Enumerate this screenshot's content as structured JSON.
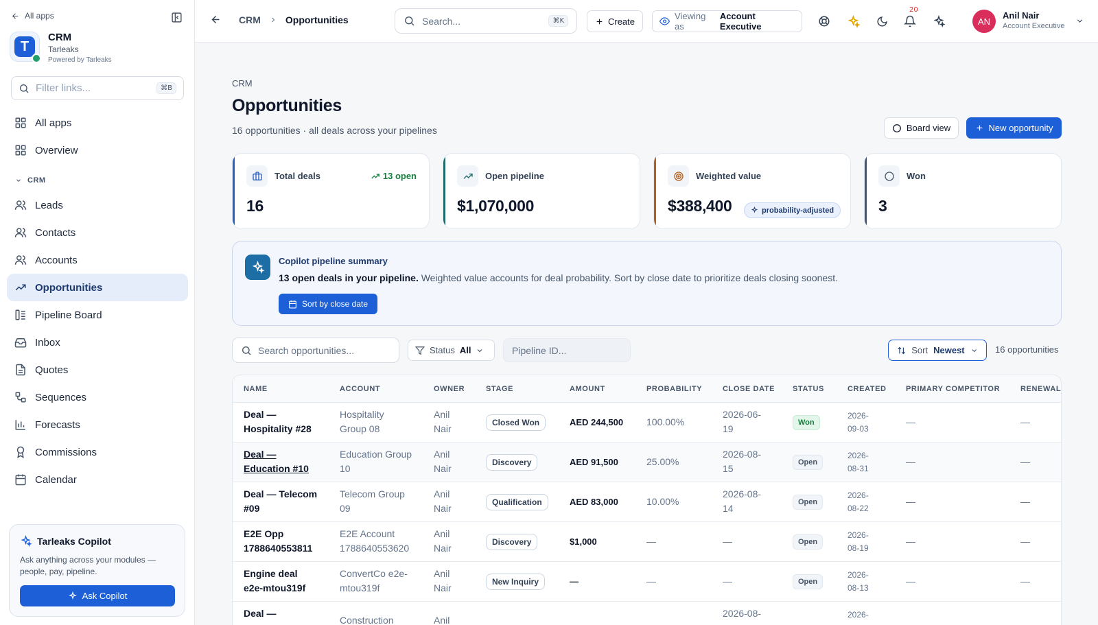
{
  "sidebar": {
    "back_label": "All apps",
    "app_title": "CRM",
    "app_org": "Tarleaks",
    "app_powered": "Powered by Tarleaks",
    "filter_placeholder": "Filter links...",
    "filter_kbd": "⌘B",
    "top_items": [
      {
        "label": "All apps",
        "icon": "grid-icon"
      },
      {
        "label": "Overview",
        "icon": "grid-icon"
      }
    ],
    "section_label": "CRM",
    "items": [
      {
        "label": "Leads",
        "icon": "users-icon"
      },
      {
        "label": "Contacts",
        "icon": "users-icon"
      },
      {
        "label": "Accounts",
        "icon": "users-icon"
      },
      {
        "label": "Opportunities",
        "icon": "trending-up-icon",
        "active": true
      },
      {
        "label": "Pipeline Board",
        "icon": "board-icon"
      },
      {
        "label": "Inbox",
        "icon": "inbox-icon"
      },
      {
        "label": "Quotes",
        "icon": "file-icon"
      },
      {
        "label": "Sequences",
        "icon": "sequence-icon"
      },
      {
        "label": "Forecasts",
        "icon": "bar-chart-icon"
      },
      {
        "label": "Commissions",
        "icon": "award-icon"
      },
      {
        "label": "Calendar",
        "icon": "calendar-icon"
      }
    ],
    "copilot": {
      "title": "Tarleaks Copilot",
      "description": "Ask anything across your modules — people, pay, pipeline.",
      "button": "Ask Copilot"
    }
  },
  "topbar": {
    "crumb_root": "CRM",
    "crumb_current": "Opportunities",
    "search_placeholder": "Search...",
    "search_kbd": "⌘K",
    "create_label": "Create",
    "viewing_label": "Viewing as",
    "viewing_value": "Account Executive",
    "notifications_count": "20",
    "user_initials": "AN",
    "user_name": "Anil Nair",
    "user_role": "Account Executive"
  },
  "page": {
    "crumb": "CRM",
    "title": "Opportunities",
    "subtitle": "16 opportunities · all deals across your pipelines",
    "board_view_label": "Board view",
    "new_opportunity_label": "New opportunity"
  },
  "stats": [
    {
      "label": "Total deals",
      "value": "16",
      "trend": "13 open",
      "accent": "#2c5fbf",
      "icon": "briefcase-icon"
    },
    {
      "label": "Open pipeline",
      "value": "$1,070,000",
      "accent": "#1f6b6b",
      "icon": "trending-up-icon"
    },
    {
      "label": "Weighted value",
      "value": "$388,400",
      "pill": "probability-adjusted",
      "accent": "#b45f1e",
      "icon": "target-icon"
    },
    {
      "label": "Won",
      "value": "3",
      "accent": "#475569",
      "icon": "circle-icon"
    }
  ],
  "summary": {
    "title": "Copilot pipeline summary",
    "bold": "13 open deals in your pipeline.",
    "text": " Weighted value accounts for deal probability. Sort by close date to prioritize deals closing soonest.",
    "button": "Sort by close date"
  },
  "filters": {
    "search_placeholder": "Search opportunities...",
    "status_label": "Status",
    "status_value": "All",
    "pipeline_placeholder": "Pipeline ID...",
    "sort_label": "Sort",
    "sort_value": "Newest",
    "count": "16 opportunities"
  },
  "table": {
    "columns": [
      "NAME",
      "ACCOUNT",
      "OWNER",
      "STAGE",
      "AMOUNT",
      "PROBABILITY",
      "CLOSE DATE",
      "STATUS",
      "CREATED",
      "PRIMARY COMPETITOR",
      "RENEWAL"
    ],
    "rows": [
      {
        "name": [
          "Deal —",
          "Hospitality #28"
        ],
        "account": [
          "Hospitality",
          "Group 08"
        ],
        "owner": [
          "Anil",
          "Nair"
        ],
        "stage": "Closed Won",
        "amount": "AED 244,500",
        "probability": "100.00%",
        "close": [
          "2026-06-",
          "19"
        ],
        "status": "Won",
        "created": [
          "2026-",
          "09-03"
        ],
        "competitor": "—",
        "renewal": "—"
      },
      {
        "name": [
          "Deal —",
          "Education #10"
        ],
        "account": [
          "Education Group",
          "10"
        ],
        "owner": [
          "Anil",
          "Nair"
        ],
        "stage": "Discovery",
        "amount": "AED 91,500",
        "probability": "25.00%",
        "close": [
          "2026-08-",
          "15"
        ],
        "status": "Open",
        "created": [
          "2026-",
          "08-31"
        ],
        "competitor": "—",
        "renewal": "—"
      },
      {
        "name": [
          "Deal — Telecom",
          "#09"
        ],
        "account": [
          "Telecom Group",
          "09"
        ],
        "owner": [
          "Anil",
          "Nair"
        ],
        "stage": "Qualification",
        "amount": "AED 83,000",
        "probability": "10.00%",
        "close": [
          "2026-08-",
          "14"
        ],
        "status": "Open",
        "created": [
          "2026-",
          "08-22"
        ],
        "competitor": "—",
        "renewal": "—"
      },
      {
        "name": [
          "E2E Opp",
          "1788640553811"
        ],
        "account": [
          "E2E Account",
          "1788640553620"
        ],
        "owner": [
          "Anil",
          "Nair"
        ],
        "stage": "Discovery",
        "amount": "$1,000",
        "probability": "—",
        "close": [
          "—",
          ""
        ],
        "status": "Open",
        "created": [
          "2026-",
          "08-19"
        ],
        "competitor": "—",
        "renewal": "—"
      },
      {
        "name": [
          "Engine deal",
          "e2e-mtou319f"
        ],
        "account": [
          "ConvertCo e2e-",
          "mtou319f"
        ],
        "owner": [
          "Anil",
          "Nair"
        ],
        "stage": "New Inquiry",
        "amount": "—",
        "probability": "—",
        "close": [
          "—",
          ""
        ],
        "status": "Open",
        "created": [
          "2026-",
          "08-13"
        ],
        "competitor": "—",
        "renewal": "—"
      },
      {
        "name": [
          "Deal —",
          ""
        ],
        "account": [
          "Construction",
          ""
        ],
        "owner": [
          "Anil",
          ""
        ],
        "stage": "",
        "amount": "",
        "probability": "",
        "close": [
          "2026-08-",
          ""
        ],
        "status": "",
        "created": [
          "2026-",
          ""
        ],
        "competitor": "",
        "renewal": ""
      }
    ]
  }
}
